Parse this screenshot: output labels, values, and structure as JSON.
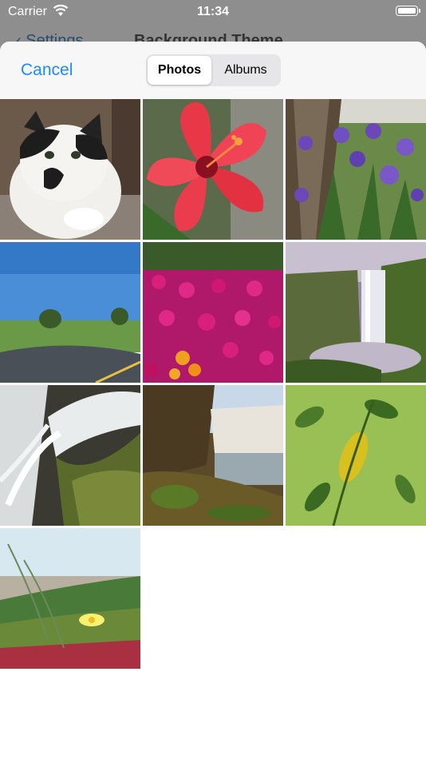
{
  "status_bar": {
    "carrier": "Carrier",
    "time": "11:34"
  },
  "underlying_nav": {
    "back_label": "Settings",
    "title": "Background Theme"
  },
  "sheet": {
    "cancel_label": "Cancel",
    "segments": [
      {
        "label": "Photos",
        "selected": true
      },
      {
        "label": "Albums",
        "selected": false
      }
    ]
  },
  "photos": [
    {
      "subject": "Black and white cat"
    },
    {
      "subject": "Pink hibiscus flower"
    },
    {
      "subject": "Purple irises by tree trunk"
    },
    {
      "subject": "Road through green field"
    },
    {
      "subject": "Magenta and orange flower bed"
    },
    {
      "subject": "Waterfall in misty valley"
    },
    {
      "subject": "Water over mossy rocks"
    },
    {
      "subject": "Waterfall at sunrise"
    },
    {
      "subject": "Green leaves with yellow leaf"
    },
    {
      "subject": "Yellow flower in dune grass"
    }
  ],
  "colors": {
    "accent": "#1a8cff"
  }
}
